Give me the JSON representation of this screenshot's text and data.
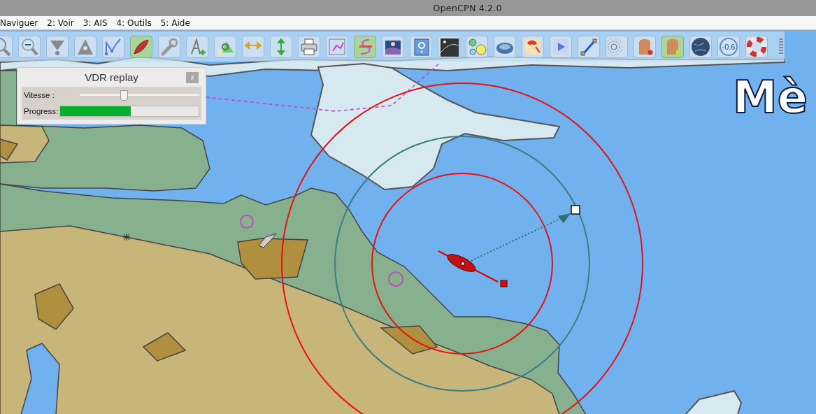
{
  "window": {
    "title": "OpenCPN 4.2.0"
  },
  "menu": [
    "Naviguer",
    "2: Voir",
    "3: AIS",
    "4: Outils",
    "5: Aide"
  ],
  "toolbar": [
    {
      "on": false
    },
    {
      "on": false
    },
    {
      "on": false
    },
    {
      "on": false
    },
    {
      "on": false
    },
    {
      "on": true
    },
    {
      "on": false
    },
    {
      "on": false
    },
    {
      "on": false
    },
    {
      "on": false
    },
    {
      "on": false
    },
    {
      "on": false
    },
    {
      "on": false
    },
    {
      "on": true
    },
    {
      "on": false
    },
    {
      "on": false
    },
    {
      "on": false
    },
    {
      "on": false
    },
    {
      "on": false
    },
    {
      "on": false
    },
    {
      "on": false
    },
    {
      "on": false
    },
    {
      "on": false
    },
    {
      "on": false
    },
    {
      "on": true
    },
    {
      "on": false
    },
    {
      "on": false,
      "label": "-0.6"
    },
    {
      "on": false
    }
  ],
  "vdr_panel": {
    "title": "VDR replay",
    "close": "x",
    "speed": {
      "label": "Vitesse :",
      "level": 0.37
    },
    "progress": {
      "label": "Progress:",
      "level": 0.51
    }
  },
  "chart": {
    "place_label": "Mè"
  }
}
